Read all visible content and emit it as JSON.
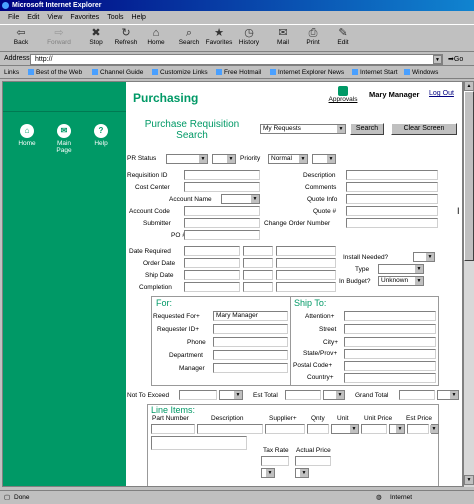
{
  "window": {
    "title": "Microsoft Internet Explorer"
  },
  "menu": [
    "File",
    "Edit",
    "View",
    "Favorites",
    "Tools",
    "Help"
  ],
  "toolbar": [
    "Back",
    "Forward",
    "Stop",
    "Refresh",
    "Home",
    "Search",
    "Favorites",
    "History",
    "Mail",
    "Print",
    "Edit"
  ],
  "address": {
    "label": "Address",
    "value": "http://",
    "go": "Go"
  },
  "links": {
    "label": "Links",
    "items": [
      "Best of the Web",
      "Channel Guide",
      "Customize Links",
      "Free Hotmail",
      "Internet Explorer News",
      "Internet Start",
      "Windows"
    ]
  },
  "sidebar": {
    "items": [
      "Home",
      "Main Page",
      "Help"
    ]
  },
  "header": {
    "title": "Purchasing",
    "approvals": "Approvals",
    "user": "Mary Manager",
    "logout": "Log Out"
  },
  "search": {
    "title": "Purchase Requisition Search",
    "scope": "My Requests",
    "search_btn": "Search",
    "clear_btn": "Clear Screen"
  },
  "form": {
    "pr_status": "PR Status",
    "priority": "Priority",
    "priority_value": "Normal",
    "left": [
      "Requisition ID",
      "Cost Center",
      "Account Name",
      "Account Code",
      "Submitter",
      "PO #"
    ],
    "right": [
      "Description",
      "Comments",
      "Quote Info",
      "Quote #",
      "Change Order Number"
    ],
    "dates": [
      "Date Required",
      "Order Date",
      "Ship Date",
      "Completion"
    ],
    "install": "Install Needed?",
    "type": "Type",
    "budget": "In Budget?",
    "budget_value": "Unknown"
  },
  "for": {
    "title": "For:",
    "labels": [
      "Requested For+",
      "Requester ID+",
      "Phone",
      "Department",
      "Manager"
    ],
    "requested_for": "Mary Manager"
  },
  "ship": {
    "title": "Ship To:",
    "labels": [
      "Attention+",
      "Street",
      "City+",
      "State/Prov+",
      "Postal Code+",
      "Country+"
    ]
  },
  "totals": {
    "nte": "Not To Exceed",
    "est": "Est Total",
    "grand": "Grand Total"
  },
  "lines": {
    "title": "Line Items:",
    "cols": [
      "Part Number",
      "Description",
      "Supplier+",
      "Qnty",
      "Unit",
      "Unit Price",
      "Est Price"
    ],
    "tax": "Tax Rate",
    "actual": "Actual Price"
  },
  "status": {
    "left": "Done",
    "right": "Internet"
  }
}
